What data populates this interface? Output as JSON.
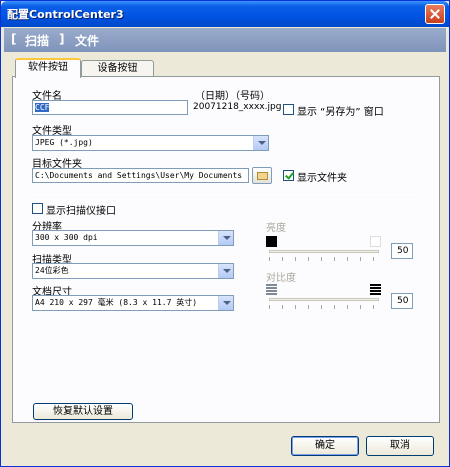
{
  "window": {
    "title": "配置ControlCenter3"
  },
  "banner": {
    "bracket_open": "[",
    "section": "扫描",
    "bracket_close": "]",
    "subsection": "文件"
  },
  "tabs": [
    {
      "label": "软件按钮",
      "active": true
    },
    {
      "label": "设备按钮",
      "active": false
    }
  ],
  "file": {
    "name_label": "文件名",
    "name_value": "CCF",
    "date_label": "（日期）（号码）",
    "date_value": "20071218_xxxx.jpg",
    "show_save_as_label": "显示 “另存为” 窗口",
    "show_save_as_checked": false,
    "type_label": "文件类型",
    "type_value": "JPEG (*.jpg)",
    "dest_label": "目标文件夹",
    "dest_value": "C:\\Documents and Settings\\User\\My Documents",
    "show_folder_label": "显示文件夹",
    "show_folder_checked": true
  },
  "scan": {
    "show_interface_label": "显示扫描仪接口",
    "show_interface_checked": false,
    "resolution_label": "分辨率",
    "resolution_value": "300 x 300 dpi",
    "scan_type_label": "扫描类型",
    "scan_type_value": "24位彩色",
    "doc_size_label": "文档尺寸",
    "doc_size_value": "A4 210 x 297 毫米 (8.3 x 11.7 英寸)",
    "brightness_label": "亮度",
    "brightness_value": "50",
    "contrast_label": "对比度",
    "contrast_value": "50",
    "sliders_enabled": false
  },
  "buttons": {
    "restore_defaults": "恢复默认设置",
    "ok": "确定",
    "cancel": "取消"
  },
  "colors": {
    "titlebar": "#0054e3",
    "banner": "#8598be",
    "window_bg": "#ece9d8",
    "panel_bg": "#fcfcfe",
    "selection": "#316ac5",
    "disabled_text": "#a9a89c"
  }
}
